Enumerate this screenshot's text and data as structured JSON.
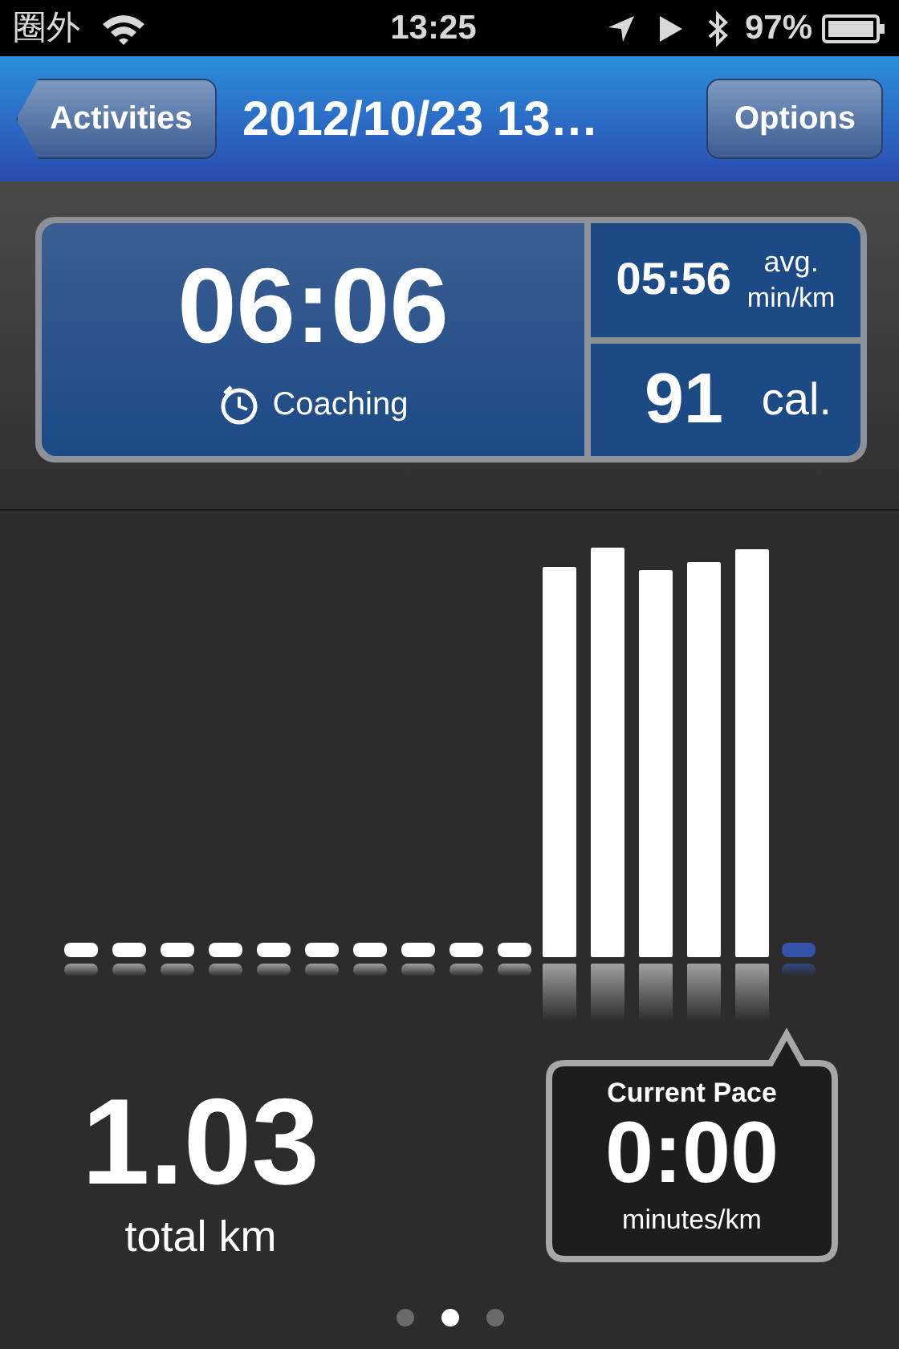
{
  "status_bar": {
    "carrier": "圈外",
    "time": "13:25",
    "battery": "97%"
  },
  "nav_bar": {
    "back_button": "Activities",
    "title": "2012/10/23 13…",
    "options_button": "Options"
  },
  "stats": {
    "duration": "06:06",
    "coaching": "Coaching",
    "avg_pace": "05:56",
    "avg_label": "avg.",
    "avg_unit": "min/km",
    "calories": "91",
    "calories_unit": "cal."
  },
  "distance": {
    "value": "1.03",
    "label": "total km"
  },
  "current_pace": {
    "title": "Current Pace",
    "value": "0:00",
    "unit": "minutes/km"
  },
  "pages": [
    {
      "selected": false
    },
    {
      "selected": true
    },
    {
      "selected": false
    }
  ]
}
